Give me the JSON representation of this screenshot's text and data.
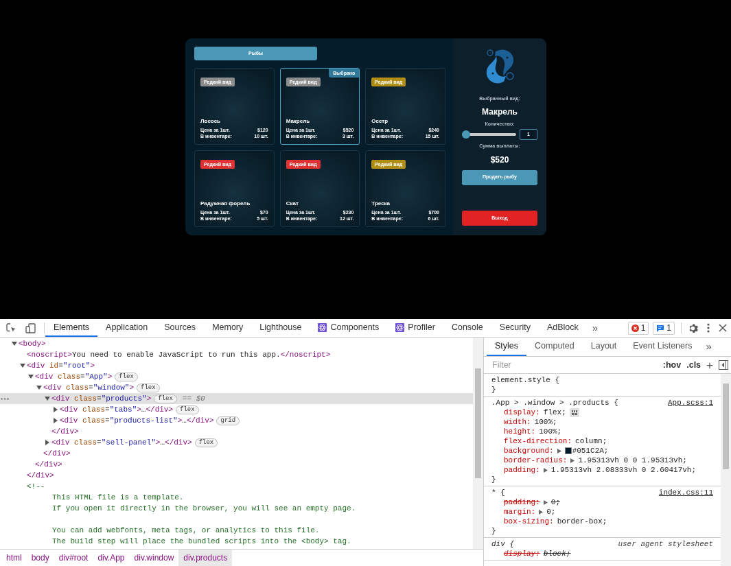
{
  "app": {
    "tabs": [
      {
        "label": "Рыбы",
        "selected": true
      }
    ],
    "selected_label": "Выбрано",
    "products": [
      {
        "badge": "Редкий вид",
        "color": "#8c8c8c",
        "name": "Лосось",
        "price_label": "Цена за 1шт.",
        "price": "$120",
        "stock_label": "В инвентаре:",
        "stock": "10 шт.",
        "selected": false
      },
      {
        "badge": "Редкий вид",
        "color": "#8c8c8c",
        "name": "Макрель",
        "price_label": "Цена за 1шт.",
        "price": "$520",
        "stock_label": "В инвентаре:",
        "stock": "3 шт.",
        "selected": true
      },
      {
        "badge": "Редкий вид",
        "color": "#b08f14",
        "name": "Осетр",
        "price_label": "Цена за 1шт.",
        "price": "$240",
        "stock_label": "В инвентаре:",
        "stock": "15 шт.",
        "selected": false
      },
      {
        "badge": "Редкий вид",
        "color": "#e03232",
        "name": "Радужная форель",
        "price_label": "Цена за 1шт.",
        "price": "$70",
        "stock_label": "В инвентаре:",
        "stock": "5 шт.",
        "selected": false
      },
      {
        "badge": "Редкий вид",
        "color": "#e03232",
        "name": "Скат",
        "price_label": "Цена за 1шт.",
        "price": "$230",
        "stock_label": "В инвентаре:",
        "stock": "12 шт.",
        "selected": false
      },
      {
        "badge": "Редкий вид",
        "color": "#b08f14",
        "name": "Треска",
        "price_label": "Цена за 1шт.",
        "price": "$700",
        "stock_label": "В инвентаре:",
        "stock": "6 шт.",
        "selected": false
      }
    ],
    "sell_panel": {
      "selected_label": "Выбранный вид:",
      "selected_name": "Макрель",
      "quantity_label": "Количество:",
      "quantity": {
        "level": 0
      },
      "quantity_value": "1",
      "sum_label": "Сумма выплаты:",
      "sum": "$520",
      "sell_button": "Продать рыбу",
      "exit_button": "Выход"
    }
  },
  "devtools": {
    "toolbar": {
      "tabs": [
        {
          "label": "Elements",
          "selected": true,
          "kind": "plain"
        },
        {
          "label": "Application",
          "selected": false,
          "kind": "plain"
        },
        {
          "label": "Sources",
          "selected": false,
          "kind": "plain"
        },
        {
          "label": "Memory",
          "selected": false,
          "kind": "plain"
        },
        {
          "label": "Lighthouse",
          "selected": false,
          "kind": "plain"
        },
        {
          "label": "Components",
          "selected": false,
          "kind": "react"
        },
        {
          "label": "Profiler",
          "selected": false,
          "kind": "react"
        },
        {
          "label": "Console",
          "selected": false,
          "kind": "plain"
        },
        {
          "label": "Security",
          "selected": false,
          "kind": "plain"
        },
        {
          "label": "AdBlock",
          "selected": false,
          "kind": "plain"
        }
      ],
      "more": "»",
      "errors": "1",
      "messages": "1"
    },
    "elements": {
      "tree": [
        {
          "kind": "element",
          "expanded": true,
          "selected": false,
          "open": [
            {
              "kind": "tag",
              "text": "<body>"
            }
          ],
          "children": [
            {
              "kind": "leaf",
              "selected": false,
              "open": [
                {
                  "kind": "tag",
                  "text": "<noscript>"
                },
                {
                  "kind": "text",
                  "text": "You need to enable JavaScript to run this app."
                },
                {
                  "kind": "tag",
                  "text": "</noscript>"
                }
              ]
            },
            {
              "kind": "element",
              "expanded": true,
              "selected": false,
              "open": [
                {
                  "kind": "tag",
                  "text": "<div"
                },
                {
                  "kind": "attr",
                  "text": " id"
                },
                {
                  "kind": "text",
                  "text": "="
                },
                {
                  "kind": "value",
                  "text": "\"root\""
                },
                {
                  "kind": "tag",
                  "text": ">"
                }
              ],
              "close": [
                {
                  "kind": "tag",
                  "text": "</div>"
                }
              ],
              "children": [
                {
                  "kind": "element",
                  "expanded": true,
                  "selected": false,
                  "badge": "flex",
                  "open": [
                    {
                      "kind": "tag",
                      "text": "<div"
                    },
                    {
                      "kind": "attr",
                      "text": " class"
                    },
                    {
                      "kind": "text",
                      "text": "="
                    },
                    {
                      "kind": "value",
                      "text": "\"App\""
                    },
                    {
                      "kind": "tag",
                      "text": ">"
                    }
                  ],
                  "close": [
                    {
                      "kind": "tag",
                      "text": "</div>"
                    }
                  ],
                  "children": [
                    {
                      "kind": "element",
                      "expanded": true,
                      "selected": false,
                      "badge": "flex",
                      "open": [
                        {
                          "kind": "tag",
                          "text": "<div"
                        },
                        {
                          "kind": "attr",
                          "text": " class"
                        },
                        {
                          "kind": "text",
                          "text": "="
                        },
                        {
                          "kind": "value",
                          "text": "\"window\""
                        },
                        {
                          "kind": "tag",
                          "text": ">"
                        }
                      ],
                      "close": [
                        {
                          "kind": "tag",
                          "text": "</div>"
                        }
                      ],
                      "children": [
                        {
                          "kind": "element",
                          "expanded": true,
                          "selected": true,
                          "badge": "flex",
                          "marker": "== $0",
                          "open": [
                            {
                              "kind": "tag",
                              "text": "<div"
                            },
                            {
                              "kind": "attr",
                              "text": " class"
                            },
                            {
                              "kind": "text",
                              "text": "="
                            },
                            {
                              "kind": "value",
                              "text": "\"products\""
                            },
                            {
                              "kind": "tag",
                              "text": ">"
                            }
                          ],
                          "close": [
                            {
                              "kind": "tag",
                              "text": "</div>"
                            }
                          ],
                          "children": [
                            {
                              "kind": "element",
                              "expanded": false,
                              "selected": false,
                              "badge": "flex",
                              "open": [
                                {
                                  "kind": "tag",
                                  "text": "<div"
                                },
                                {
                                  "kind": "attr",
                                  "text": " class"
                                },
                                {
                                  "kind": "text",
                                  "text": "="
                                },
                                {
                                  "kind": "value",
                                  "text": "\"tabs\""
                                },
                                {
                                  "kind": "tag",
                                  "text": ">"
                                },
                                {
                                  "kind": "text",
                                  "text": "…"
                                },
                                {
                                  "kind": "tag",
                                  "text": "</div>"
                                }
                              ]
                            },
                            {
                              "kind": "element",
                              "expanded": false,
                              "selected": false,
                              "badge": "grid",
                              "open": [
                                {
                                  "kind": "tag",
                                  "text": "<div"
                                },
                                {
                                  "kind": "attr",
                                  "text": " class"
                                },
                                {
                                  "kind": "text",
                                  "text": "="
                                },
                                {
                                  "kind": "value",
                                  "text": "\"products-list\""
                                },
                                {
                                  "kind": "tag",
                                  "text": ">"
                                },
                                {
                                  "kind": "text",
                                  "text": "…"
                                },
                                {
                                  "kind": "tag",
                                  "text": "</div>"
                                }
                              ]
                            }
                          ]
                        },
                        {
                          "kind": "element",
                          "expanded": false,
                          "selected": false,
                          "badge": "flex",
                          "open": [
                            {
                              "kind": "tag",
                              "text": "<div"
                            },
                            {
                              "kind": "attr",
                              "text": " class"
                            },
                            {
                              "kind": "text",
                              "text": "="
                            },
                            {
                              "kind": "value",
                              "text": "\"sell-panel\""
                            },
                            {
                              "kind": "tag",
                              "text": ">"
                            },
                            {
                              "kind": "text",
                              "text": "…"
                            },
                            {
                              "kind": "tag",
                              "text": "</div>"
                            }
                          ]
                        }
                      ]
                    }
                  ]
                }
              ]
            },
            {
              "kind": "comment",
              "selected": false,
              "open": "<!--",
              "blocks": [
                [
                  "This HTML file is a template.",
                  "If you open it directly in the browser, you will see an empty page."
                ],
                [
                  "You can add webfonts, meta tags, or analytics to this file.",
                  "The build step will place the bundled scripts into the <body> tag."
                ]
              ]
            }
          ]
        }
      ],
      "breadcrumbs": [
        {
          "label": "html",
          "selected": false
        },
        {
          "label": "body",
          "selected": false
        },
        {
          "label": "div#root",
          "selected": false
        },
        {
          "label": "div.App",
          "selected": false
        },
        {
          "label": "div.window",
          "selected": false
        },
        {
          "label": "div.products",
          "selected": true
        }
      ]
    },
    "styles": {
      "tabs": [
        {
          "label": "Styles",
          "selected": true
        },
        {
          "label": "Computed",
          "selected": false
        },
        {
          "label": "Layout",
          "selected": false
        },
        {
          "label": "Event Listeners",
          "selected": false
        }
      ],
      "more": "»",
      "filter_placeholder": "Filter",
      "hov": ":hov",
      "cls": ".cls",
      "add": "+",
      "rules": [
        {
          "selector": "element.style {",
          "close": "}"
        },
        {
          "selector": ".App > .window > .products {",
          "source": "App.scss:1",
          "user_agent": false,
          "close": "}",
          "properties": [
            {
              "name": "display:",
              "value": "flex;",
              "kind": "flex",
              "overridden": false
            },
            {
              "name": "width:",
              "value": "100%;",
              "kind": "plain",
              "overridden": false
            },
            {
              "name": "height:",
              "value": "100%;",
              "kind": "plain",
              "overridden": false
            },
            {
              "name": "flex-direction:",
              "value": "column;",
              "kind": "plain",
              "overridden": false
            },
            {
              "name": "background:",
              "value": "#051C2A;",
              "kind": "color",
              "color": "#051c2a",
              "overridden": false
            },
            {
              "name": "border-radius:",
              "value": "1.95313vh 0 0 1.95313vh;",
              "kind": "expandable",
              "overridden": false
            },
            {
              "name": "padding:",
              "value": "1.95313vh 2.08333vh 0 2.60417vh;",
              "kind": "expandable",
              "overridden": false
            }
          ]
        },
        {
          "selector": "* {",
          "source": "index.css:11",
          "user_agent": false,
          "close": "}",
          "properties": [
            {
              "name": "padding:",
              "value": "0;",
              "kind": "expandable",
              "overridden": true
            },
            {
              "name": "margin:",
              "value": "0;",
              "kind": "expandable",
              "overridden": false
            },
            {
              "name": "box-sizing:",
              "value": "border-box;",
              "kind": "plain",
              "overridden": false
            }
          ]
        },
        {
          "selector": "div {",
          "source": "user agent stylesheet",
          "user_agent": true,
          "properties": [
            {
              "name": "display:",
              "value": "block;",
              "kind": "plain",
              "overridden": true
            }
          ]
        }
      ]
    }
  }
}
